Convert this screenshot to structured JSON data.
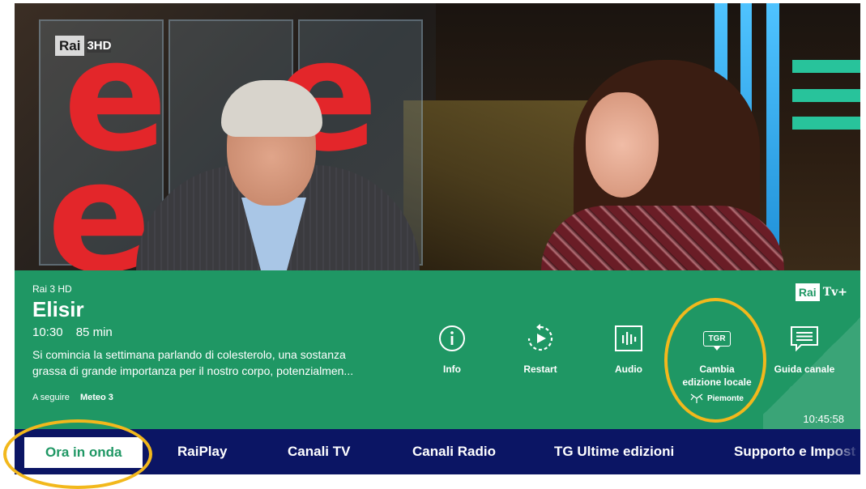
{
  "video": {
    "channel_logo": {
      "rai": "Rai",
      "num": "3HD"
    }
  },
  "info": {
    "channel_name": "Rai 3 HD",
    "title": "Elisir",
    "time": "10:30",
    "duration": "85 min",
    "description_line1": "Si comincia la settimana parlando di colesterolo, una sostanza",
    "description_line2": "grassa di grande importanza per il nostro corpo, potenzialmen...",
    "next_label": "A seguire",
    "next_title": "Meteo 3",
    "brand": {
      "rai": "Rai",
      "tv": "Tv+"
    },
    "clock": "10:45:58"
  },
  "actions": {
    "info": {
      "label": "Info",
      "icon": "info-circle-icon"
    },
    "restart": {
      "label": "Restart",
      "icon": "restart-icon"
    },
    "audio": {
      "label": "Audio",
      "icon": "audio-icon"
    },
    "local": {
      "label1": "Cambia",
      "label2": "edizione locale",
      "badge": "TGR",
      "region": "Piemonte",
      "icon": "tgr-icon"
    },
    "guide": {
      "label": "Guida canale",
      "icon": "guide-icon"
    }
  },
  "nav": {
    "items": [
      "Ora in onda",
      "RaiPlay",
      "Canali TV",
      "Canali Radio",
      "TG Ultime edizioni",
      "Supporto e Impost"
    ],
    "active_index": 0
  },
  "colors": {
    "panel": "#1f9764",
    "nav": "#0b1564",
    "highlight": "#f2b81c"
  }
}
